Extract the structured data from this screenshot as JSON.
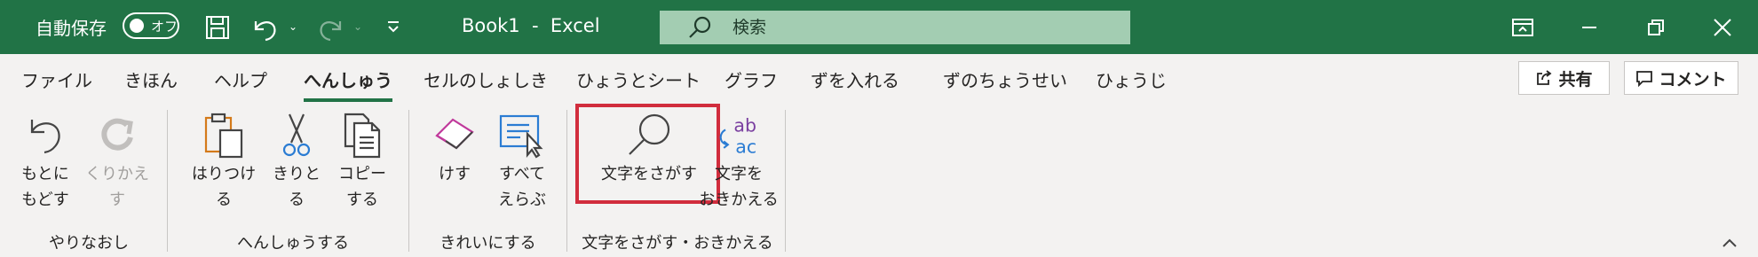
{
  "titlebar": {
    "autosave_label": "自動保存",
    "autosave_toggle": "オフ",
    "doc_title": "Book1  -  Excel",
    "search_placeholder": "検索"
  },
  "tabs": [
    {
      "label": "ファイル",
      "active": false
    },
    {
      "label": "きほん",
      "active": false
    },
    {
      "label": "ヘルプ",
      "active": false
    },
    {
      "label": "へんしゅう",
      "active": true
    },
    {
      "label": "セルのしょしき",
      "active": false
    },
    {
      "label": "ひょうとシート",
      "active": false
    },
    {
      "label": "グラフ",
      "active": false
    },
    {
      "label": "ずを入れる",
      "active": false
    },
    {
      "label": "ずのちょうせい",
      "active": false
    },
    {
      "label": "ひょうじ",
      "active": false
    }
  ],
  "share_label": "共有",
  "comment_label": "コメント",
  "ribbon": {
    "undo": {
      "line1": "もとに",
      "line2": "もどす"
    },
    "redo": {
      "line1": "くりかえす"
    },
    "paste": {
      "line1": "はりつける"
    },
    "cut": {
      "line1": "きりとる"
    },
    "copy": {
      "line1": "コピー",
      "line2": "する"
    },
    "clear": {
      "line1": "けす"
    },
    "select_all": {
      "line1": "すべて",
      "line2": "えらぶ"
    },
    "find": {
      "line1": "文字をさがす"
    },
    "replace": {
      "line1": "文字を",
      "line2": "おきかえる"
    },
    "groups": [
      "やりなおし",
      "へんしゅうする",
      "きれいにする",
      "文字をさがす・おきかえる"
    ],
    "replace_icon_text": {
      "top": "ab",
      "bottom": "ac"
    }
  },
  "colors": {
    "accent": "#217346",
    "highlight": "#d12d3d",
    "search_bg": "#a3cdb2"
  }
}
